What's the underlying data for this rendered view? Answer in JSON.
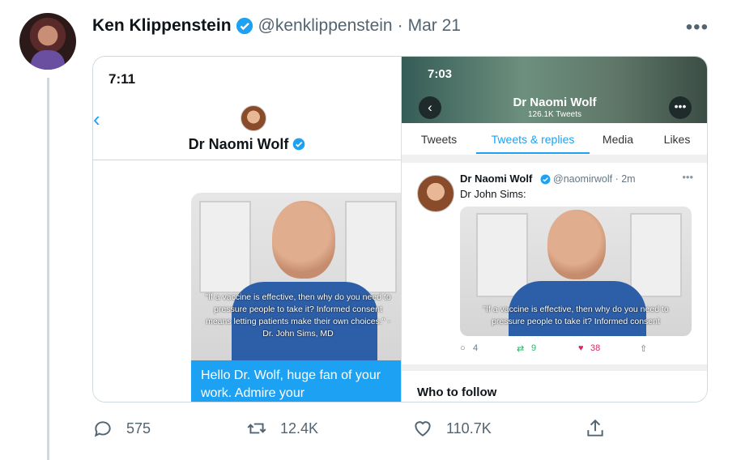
{
  "author": {
    "name": "Ken Klippenstein",
    "handle": "@kenklippenstein",
    "date_sep": "·",
    "date": "Mar 21"
  },
  "more_label": "•••",
  "left_phone": {
    "time": "7:11",
    "back": "‹",
    "profile_name": "Dr Naomi Wolf",
    "quote": "\"If a vaccine is effective, then why do you need to pressure people to take it? Informed consent means letting patients make their own choices.\" - Dr. John Sims, MD",
    "message": "Hello Dr. Wolf, huge fan of your work. Admire your outspokenness"
  },
  "right_phone": {
    "time": "7:03",
    "back": "‹",
    "more": "•••",
    "profile_name": "Dr Naomi Wolf",
    "tweet_count": "126.1K Tweets",
    "tabs": [
      "Tweets",
      "Tweets & replies",
      "Media",
      "Likes"
    ],
    "tweet": {
      "name": "Dr Naomi Wolf",
      "handle": "@naomirwolf · 2m",
      "text": "Dr John Sims:",
      "quote": "\"If a vaccine is effective, then why do you need to pressure people to take it? Informed consent",
      "replies": "4",
      "retweets": "9",
      "likes": "38"
    },
    "who_to_follow": "Who to follow"
  },
  "action_bar": {
    "replies": "575",
    "retweets": "12.4K",
    "likes": "110.7K"
  },
  "colors": {
    "brand": "#1da1f2",
    "muted": "#536471",
    "like": "#e0245e",
    "retweet": "#17bf63"
  }
}
